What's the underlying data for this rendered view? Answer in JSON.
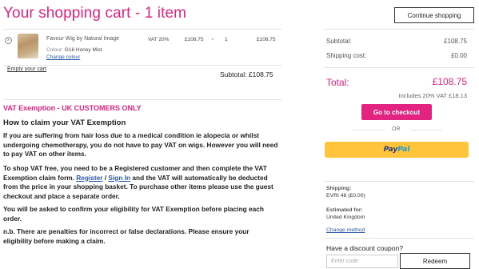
{
  "header": {
    "title": "Your shopping cart - 1 item",
    "continue_label": "Continue shopping"
  },
  "cart": {
    "item": {
      "name": "Favour Wig by Natural Image",
      "colour_label": "Colour:",
      "colour_value": "G16 Honey Mist",
      "change_colour": "Change colour",
      "vat": "VAT 20%",
      "price": "£108.75",
      "times": "×",
      "qty": "1",
      "line_total": "£108.75"
    },
    "empty_cart": "Empty your cart",
    "subtotal": "Subtotal: £108.75"
  },
  "vat_section": {
    "heading": "VAT Exemption - UK CUSTOMERS ONLY",
    "subheading": "How to claim your VAT Exemption",
    "p1": "If you are suffering from hair loss due to a medical condition ie alopecia or whilst undergoing chemotherapy, you do not have to pay VAT on wigs. However you will need to pay VAT on other items.",
    "p2_a": "To shop VAT free, you need to be a Registered customer and then complete the VAT Exemption claim form. ",
    "p2_register": "Register",
    "p2_sep": " / ",
    "p2_signin": "Sign In",
    "p2_b": " and the VAT will automatically be deducted from the price in your shopping basket. To purchase other items please use the guest checkout and place a separate order.",
    "p3": "You will be asked to confirm your eligibility for VAT Exemption before placing each order.",
    "p4": "n.b. There are penalties for incorrect or false declarations. Please ensure your eligibility before making a claim."
  },
  "summary": {
    "subtotal_label": "Subtotal:",
    "subtotal_value": "£108.75",
    "shipping_label": "Shipping cost:",
    "shipping_value": "£0.00",
    "total_label": "Total:",
    "total_value": "£108.75",
    "includes_vat": "Includes 20% VAT £18.13",
    "checkout_label": "Go to checkout",
    "or_label": "OR",
    "paypal_pay": "Pay",
    "paypal_pal": "Pal",
    "shipping_heading": "Shipping:",
    "shipping_method": "EVRI 48 (£0.00)",
    "estimated_heading": "Estimated for:",
    "estimated_value": "United Kingdom",
    "change_method": "Change method",
    "coupon_label": "Have a discount coupon?",
    "coupon_placeholder": "Enter code",
    "redeem_label": "Redeem"
  },
  "colors": {
    "accent": "#e2237f",
    "paypal": "#ffc439"
  }
}
